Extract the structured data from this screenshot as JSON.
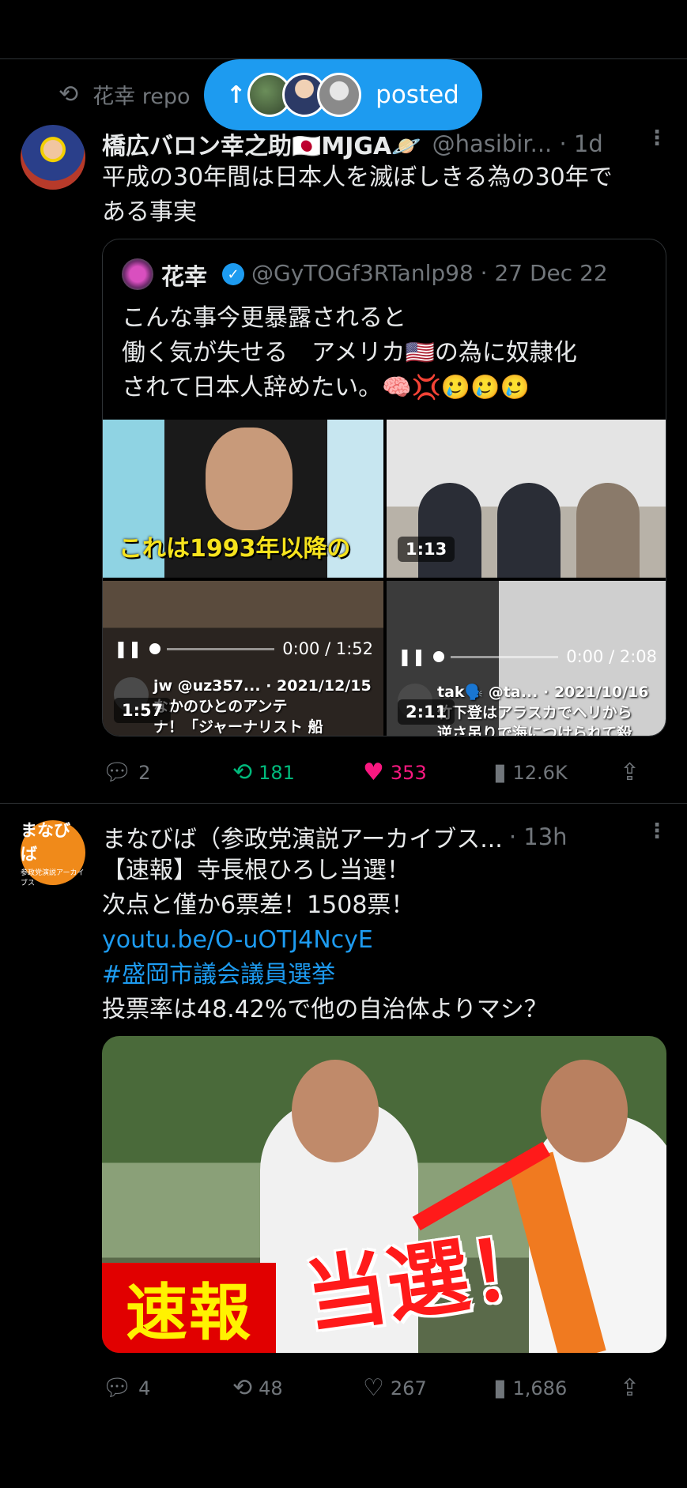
{
  "banner": {
    "label": "posted"
  },
  "repost": {
    "label": "花幸 repo"
  },
  "post1": {
    "name": "橋広バロン幸之助🇯🇵MJGA🪐",
    "handle": "@hasibir... · 1d",
    "text_line1": "平成の30年間は日本人を滅ぼしきる為の30年で",
    "text_line2": "ある事実",
    "quote": {
      "name": "花幸",
      "handle": "@GyTOGf3RTanlp98 · 27 Dec 22",
      "line1": "こんな事今更暴露されると",
      "line2": "働く気が失せる　アメリカ🇺🇸の為に奴隷化",
      "line3": "されて日本人辞めたい。🧠💢🥲🥲🥲",
      "media": [
        {
          "caption": "これは1993年以降の"
        },
        {
          "duration": "1:13"
        },
        {
          "time": "0:00 / 1:52",
          "duration": "1:57",
          "user": "jw @uz357... · 2021/12/15",
          "line1": "なかのひとのアンテ",
          "line2": "ナ！「ジャーナリスト 船"
        },
        {
          "time": "0:00 / 2:08",
          "duration": "2:11",
          "user": "tak🗣️ @ta... · 2021/10/16",
          "line1": "竹下登はアラスカでヘリから",
          "line2": "逆さ吊りで海につけられて殺"
        }
      ]
    },
    "actions": {
      "replies": "2",
      "reposts": "181",
      "likes": "353",
      "views": "12.6K"
    }
  },
  "post2": {
    "avatar_line1": "まなびば",
    "avatar_line2": "参政党演説アーカイブス",
    "name": "まなびば（参政党演説アーカイブス...",
    "handle": "· 13h",
    "line1": "【速報】寺長根ひろし当選！",
    "line2": "次点と僅か6票差！1508票！",
    "link": "youtu.be/O-uOTJ4NcyE",
    "hashtag": "#盛岡市議会議員選挙",
    "line3": "投票率は48.42%で他の自治体よりマシ？",
    "image": {
      "badge": "速報",
      "headline": "当選！"
    },
    "actions": {
      "replies": "4",
      "reposts": "48",
      "likes": "267",
      "views": "1,686"
    }
  },
  "icons": [
    "retweet-icon",
    "arrow-up-icon",
    "more-icon",
    "verified-icon",
    "reply-icon",
    "like-icon",
    "views-icon",
    "share-icon",
    "pause-icon"
  ],
  "colors": {
    "accent": "#1d9bf0",
    "repost_active": "#00ba7c",
    "like_active": "#f91880",
    "muted": "#71767b"
  }
}
